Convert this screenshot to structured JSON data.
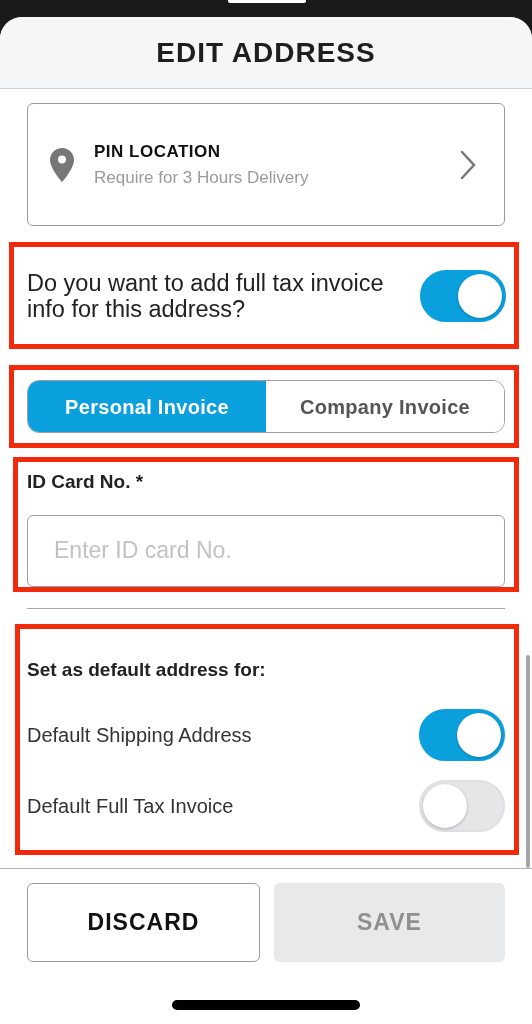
{
  "header": {
    "title": "EDIT ADDRESS"
  },
  "pin_location": {
    "title": "PIN LOCATION",
    "subtitle": "Require for 3 Hours Delivery"
  },
  "tax_invoice": {
    "highlighted": true,
    "question": "Do you want to add full tax invoice info for this address?",
    "on": true
  },
  "invoice_type": {
    "highlighted": true,
    "options": [
      {
        "label": "Personal Invoice",
        "selected": true
      },
      {
        "label": "Company Invoice",
        "selected": false
      }
    ]
  },
  "id_card": {
    "highlighted": true,
    "label": "ID Card No. *",
    "placeholder": "Enter ID card No."
  },
  "defaults": {
    "highlighted": true,
    "heading": "Set as default address for:",
    "items": [
      {
        "label": "Default Shipping Address",
        "on": true
      },
      {
        "label": "Default Full Tax Invoice",
        "on": false
      }
    ]
  },
  "buttons": [
    {
      "label": "DISCARD",
      "disabled": false
    },
    {
      "label": "SAVE",
      "disabled": true
    }
  ]
}
